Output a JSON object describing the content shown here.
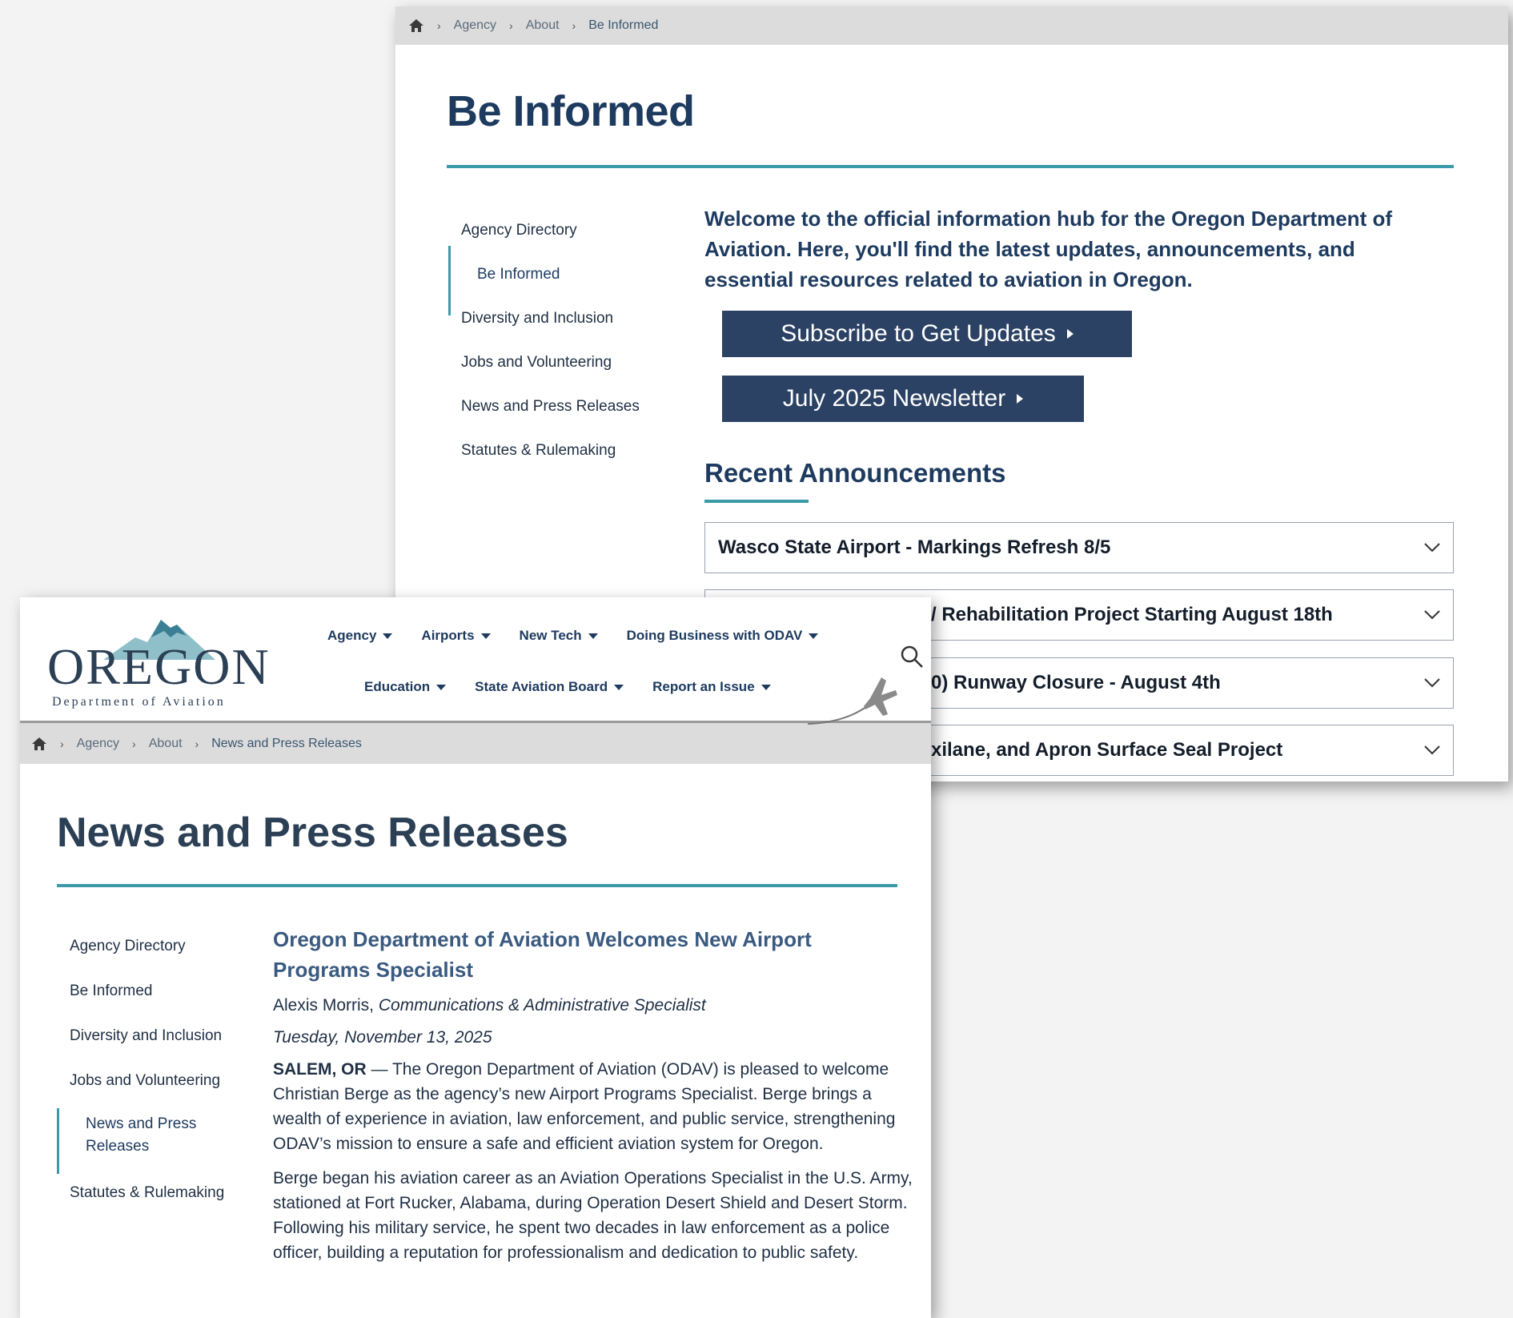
{
  "back_page": {
    "breadcrumb": [
      "Agency",
      "About",
      "Be Informed"
    ],
    "title": "Be Informed",
    "side_nav": [
      "Agency Directory",
      "Be Informed",
      "Diversity and Inclusion",
      "Jobs and Volunteering",
      "News and Press Releases",
      "Statutes & Rulemaking"
    ],
    "intro": "Welcome to the official information hub for the Oregon Department of Aviation. Here, you'll find the latest updates, announcements, and essential resources related to aviation in Oregon.",
    "buttons": {
      "subscribe": "Subscribe to Get Updates",
      "newsletter": "July 2025 Newsletter"
    },
    "recent_heading": "Recent Announcements",
    "announcements": [
      "Wasco State Airport - Markings Refresh 8/5",
      "/ Rehabilitation Project Starting August 18th",
      "0) Runway Closure - August 4th",
      "xilane, and Apron Surface Seal Project"
    ]
  },
  "front_page": {
    "logo": {
      "word": "OREGON",
      "sub": "Department of Aviation"
    },
    "menu_row_1": [
      "Agency",
      "Airports",
      "New Tech",
      "Doing Business with ODAV"
    ],
    "menu_row_2": [
      "Education",
      "State Aviation Board",
      "Report an Issue"
    ],
    "breadcrumb": [
      "Agency",
      "About",
      "News and Press Releases"
    ],
    "title": "News and Press Releases",
    "side_nav": [
      "Agency Directory",
      "Be Informed",
      "Diversity and Inclusion",
      "Jobs and Volunteering",
      "News and Press Releases",
      "Statutes & Rulemaking"
    ],
    "article": {
      "title": "Oregon Department of Aviation Welcomes New Airport Programs Specialist",
      "author": "Alexis Morris,",
      "author_role": "Communications & Administrative Specialist",
      "date": "Tuesday, November 13, 2025",
      "dateline": "SALEM, OR",
      "p1": "— The Oregon Department of Aviation (ODAV) is pleased to welcome Christian Berge as the agency’s new Airport Programs Specialist. Berge brings a wealth of experience in aviation, law enforcement, and public service, strengthening ODAV’s mission to ensure a safe and efficient aviation system for Oregon.",
      "p2": "Berge began his aviation career as an Aviation Operations Specialist in the U.S. Army, stationed at Fort Rucker, Alabama, during Operation Desert Shield and Desert Storm. Following his military service, he spent two decades in law enforcement as a police officer, building a reputation for professionalism and dedication to public safety."
    }
  },
  "colors": {
    "navy": "#1d3a5f",
    "teal": "#3a9aa8",
    "button": "#2c4264",
    "crumb_bg": "#dcdcdc"
  },
  "icons": [
    "home-icon",
    "chevron-right-icon",
    "chevron-down-icon",
    "caret-down-icon",
    "search-icon",
    "airplane-icon",
    "play-arrow-icon"
  ]
}
